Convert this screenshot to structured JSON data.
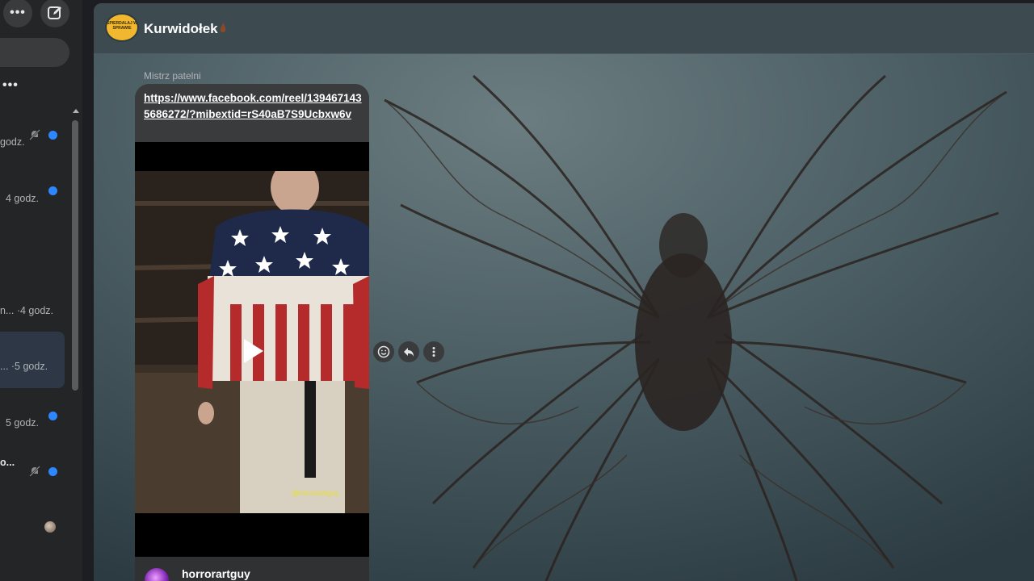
{
  "sidebar": {
    "more_icon": "more-horizontal-icon",
    "compose_icon": "compose-icon",
    "chats_menu_label": "•••",
    "conversations": [
      {
        "time": "godz.",
        "muted": true,
        "unread": true
      },
      {
        "time": "4 godz.",
        "muted": false,
        "unread": true
      },
      {
        "time": "",
        "muted": false,
        "unread": false
      },
      {
        "time": "n... ·4 godz.",
        "muted": false,
        "unread": false
      },
      {
        "time": "... ·5 godz.",
        "muted": false,
        "unread": false,
        "selected": true
      },
      {
        "time": "5 godz.",
        "muted": false,
        "unread": true
      },
      {
        "time": "o...",
        "muted": true,
        "unread": true
      },
      {
        "time": "",
        "muted": false,
        "unread": false,
        "avatar": true
      }
    ]
  },
  "chat": {
    "group_name": "Kurwidołek",
    "group_avatar_text": "SPIERDALAJ W SPRAWIE",
    "message": {
      "sender": "Mistrz patelni",
      "link": "https://www.facebook.com/reel/1394671435686272/?mibextid=rS40aB7S9Ucbxw6v",
      "video_watermark": "@horrorartguy",
      "preview_author": "horrorartguy"
    },
    "actions": {
      "react_icon": "smiley-icon",
      "reply_icon": "reply-icon",
      "more_icon": "more-vertical-icon"
    }
  },
  "colors": {
    "accent": "#2d88ff",
    "sidebar_bg": "#242526",
    "bubble_bg": "#3a3b3c"
  }
}
